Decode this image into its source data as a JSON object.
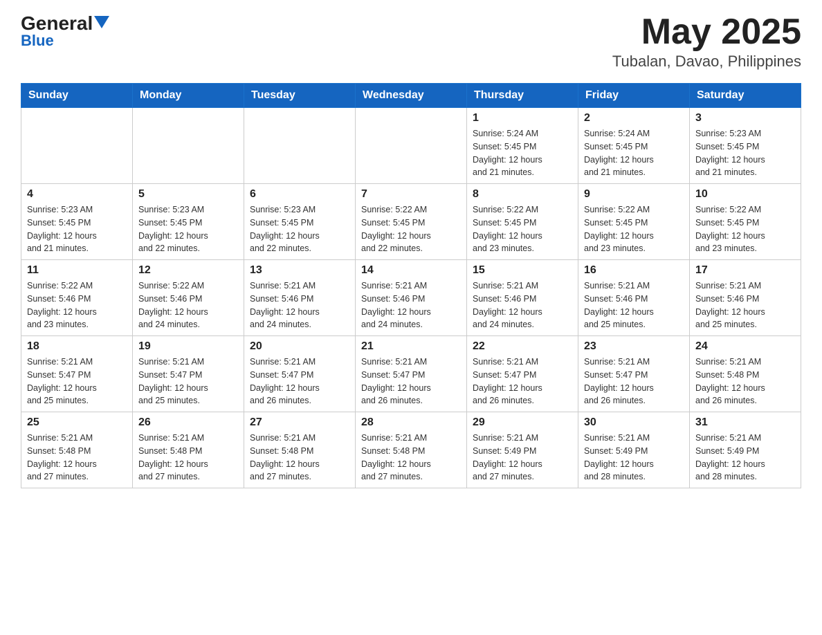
{
  "header": {
    "logo_general": "General",
    "logo_blue": "Blue",
    "month_year": "May 2025",
    "location": "Tubalan, Davao, Philippines"
  },
  "weekdays": [
    "Sunday",
    "Monday",
    "Tuesday",
    "Wednesday",
    "Thursday",
    "Friday",
    "Saturday"
  ],
  "weeks": [
    [
      {
        "day": "",
        "info": ""
      },
      {
        "day": "",
        "info": ""
      },
      {
        "day": "",
        "info": ""
      },
      {
        "day": "",
        "info": ""
      },
      {
        "day": "1",
        "info": "Sunrise: 5:24 AM\nSunset: 5:45 PM\nDaylight: 12 hours\nand 21 minutes."
      },
      {
        "day": "2",
        "info": "Sunrise: 5:24 AM\nSunset: 5:45 PM\nDaylight: 12 hours\nand 21 minutes."
      },
      {
        "day": "3",
        "info": "Sunrise: 5:23 AM\nSunset: 5:45 PM\nDaylight: 12 hours\nand 21 minutes."
      }
    ],
    [
      {
        "day": "4",
        "info": "Sunrise: 5:23 AM\nSunset: 5:45 PM\nDaylight: 12 hours\nand 21 minutes."
      },
      {
        "day": "5",
        "info": "Sunrise: 5:23 AM\nSunset: 5:45 PM\nDaylight: 12 hours\nand 22 minutes."
      },
      {
        "day": "6",
        "info": "Sunrise: 5:23 AM\nSunset: 5:45 PM\nDaylight: 12 hours\nand 22 minutes."
      },
      {
        "day": "7",
        "info": "Sunrise: 5:22 AM\nSunset: 5:45 PM\nDaylight: 12 hours\nand 22 minutes."
      },
      {
        "day": "8",
        "info": "Sunrise: 5:22 AM\nSunset: 5:45 PM\nDaylight: 12 hours\nand 23 minutes."
      },
      {
        "day": "9",
        "info": "Sunrise: 5:22 AM\nSunset: 5:45 PM\nDaylight: 12 hours\nand 23 minutes."
      },
      {
        "day": "10",
        "info": "Sunrise: 5:22 AM\nSunset: 5:45 PM\nDaylight: 12 hours\nand 23 minutes."
      }
    ],
    [
      {
        "day": "11",
        "info": "Sunrise: 5:22 AM\nSunset: 5:46 PM\nDaylight: 12 hours\nand 23 minutes."
      },
      {
        "day": "12",
        "info": "Sunrise: 5:22 AM\nSunset: 5:46 PM\nDaylight: 12 hours\nand 24 minutes."
      },
      {
        "day": "13",
        "info": "Sunrise: 5:21 AM\nSunset: 5:46 PM\nDaylight: 12 hours\nand 24 minutes."
      },
      {
        "day": "14",
        "info": "Sunrise: 5:21 AM\nSunset: 5:46 PM\nDaylight: 12 hours\nand 24 minutes."
      },
      {
        "day": "15",
        "info": "Sunrise: 5:21 AM\nSunset: 5:46 PM\nDaylight: 12 hours\nand 24 minutes."
      },
      {
        "day": "16",
        "info": "Sunrise: 5:21 AM\nSunset: 5:46 PM\nDaylight: 12 hours\nand 25 minutes."
      },
      {
        "day": "17",
        "info": "Sunrise: 5:21 AM\nSunset: 5:46 PM\nDaylight: 12 hours\nand 25 minutes."
      }
    ],
    [
      {
        "day": "18",
        "info": "Sunrise: 5:21 AM\nSunset: 5:47 PM\nDaylight: 12 hours\nand 25 minutes."
      },
      {
        "day": "19",
        "info": "Sunrise: 5:21 AM\nSunset: 5:47 PM\nDaylight: 12 hours\nand 25 minutes."
      },
      {
        "day": "20",
        "info": "Sunrise: 5:21 AM\nSunset: 5:47 PM\nDaylight: 12 hours\nand 26 minutes."
      },
      {
        "day": "21",
        "info": "Sunrise: 5:21 AM\nSunset: 5:47 PM\nDaylight: 12 hours\nand 26 minutes."
      },
      {
        "day": "22",
        "info": "Sunrise: 5:21 AM\nSunset: 5:47 PM\nDaylight: 12 hours\nand 26 minutes."
      },
      {
        "day": "23",
        "info": "Sunrise: 5:21 AM\nSunset: 5:47 PM\nDaylight: 12 hours\nand 26 minutes."
      },
      {
        "day": "24",
        "info": "Sunrise: 5:21 AM\nSunset: 5:48 PM\nDaylight: 12 hours\nand 26 minutes."
      }
    ],
    [
      {
        "day": "25",
        "info": "Sunrise: 5:21 AM\nSunset: 5:48 PM\nDaylight: 12 hours\nand 27 minutes."
      },
      {
        "day": "26",
        "info": "Sunrise: 5:21 AM\nSunset: 5:48 PM\nDaylight: 12 hours\nand 27 minutes."
      },
      {
        "day": "27",
        "info": "Sunrise: 5:21 AM\nSunset: 5:48 PM\nDaylight: 12 hours\nand 27 minutes."
      },
      {
        "day": "28",
        "info": "Sunrise: 5:21 AM\nSunset: 5:48 PM\nDaylight: 12 hours\nand 27 minutes."
      },
      {
        "day": "29",
        "info": "Sunrise: 5:21 AM\nSunset: 5:49 PM\nDaylight: 12 hours\nand 27 minutes."
      },
      {
        "day": "30",
        "info": "Sunrise: 5:21 AM\nSunset: 5:49 PM\nDaylight: 12 hours\nand 28 minutes."
      },
      {
        "day": "31",
        "info": "Sunrise: 5:21 AM\nSunset: 5:49 PM\nDaylight: 12 hours\nand 28 minutes."
      }
    ]
  ]
}
